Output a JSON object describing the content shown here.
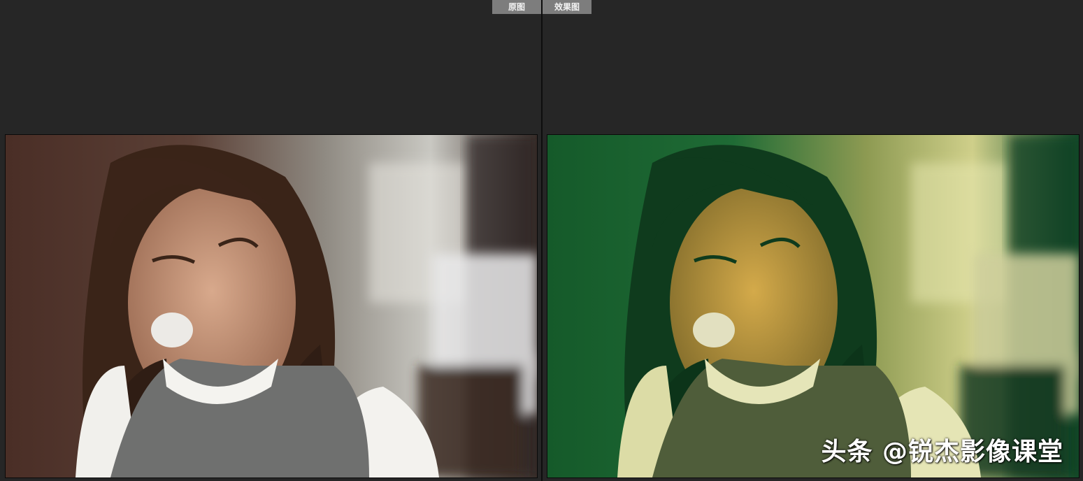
{
  "tabs": {
    "before_label": "原图",
    "after_label": "效果图"
  },
  "watermark": {
    "text": "头条 @锐杰影像课堂"
  },
  "colors": {
    "background": "#262626",
    "tab_bg": "#7d7d7d",
    "divider": "#0d0d0d",
    "original_tone": "#5a4438",
    "effect_tone": "#1f6b3a"
  },
  "images": {
    "before": {
      "name": "original-photo"
    },
    "after": {
      "name": "effect-photo"
    }
  }
}
